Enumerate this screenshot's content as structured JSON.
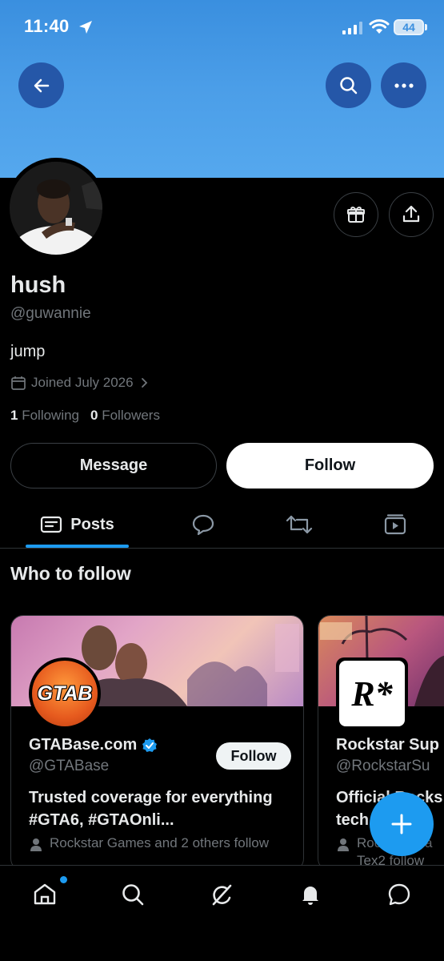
{
  "status_bar": {
    "time": "11:40",
    "battery": "44"
  },
  "profile": {
    "name": "hush",
    "handle": "@guwannie",
    "bio": "jump",
    "joined": "Joined July 2026",
    "following_count": "1",
    "following_label": "Following",
    "followers_count": "0",
    "followers_label": "Followers"
  },
  "actions": {
    "message_label": "Message",
    "follow_label": "Follow"
  },
  "tabs": [
    {
      "label": "Posts"
    }
  ],
  "who_to_follow": {
    "title": "Who to follow",
    "cards": [
      {
        "avatar_text": "GTAB",
        "name": "GTABase.com",
        "handle": "@GTABase",
        "follow_label": "Follow",
        "description": "Trusted coverage for everything #GTA6, #GTAOnli...",
        "social_context": "Rockstar Games and 2 others follow"
      },
      {
        "avatar_text": "R*",
        "name": "Rockstar Sup",
        "handle": "@RockstarSu",
        "description": "Official Rocks tech",
        "social_context": "Rockstar Ga Tex2 follow"
      }
    ]
  },
  "colors": {
    "accent": "#1d9bf0",
    "banner": "#4b9ee8",
    "muted": "#71767b"
  },
  "icons": [
    "back-arrow-icon",
    "search-icon",
    "more-icon",
    "gift-icon",
    "share-icon",
    "calendar-icon",
    "chevron-right-icon",
    "posts-icon",
    "reply-icon",
    "repost-icon",
    "media-icon",
    "person-icon",
    "verified-icon",
    "plus-icon",
    "home-icon",
    "grok-icon",
    "bell-icon",
    "messages-icon"
  ]
}
